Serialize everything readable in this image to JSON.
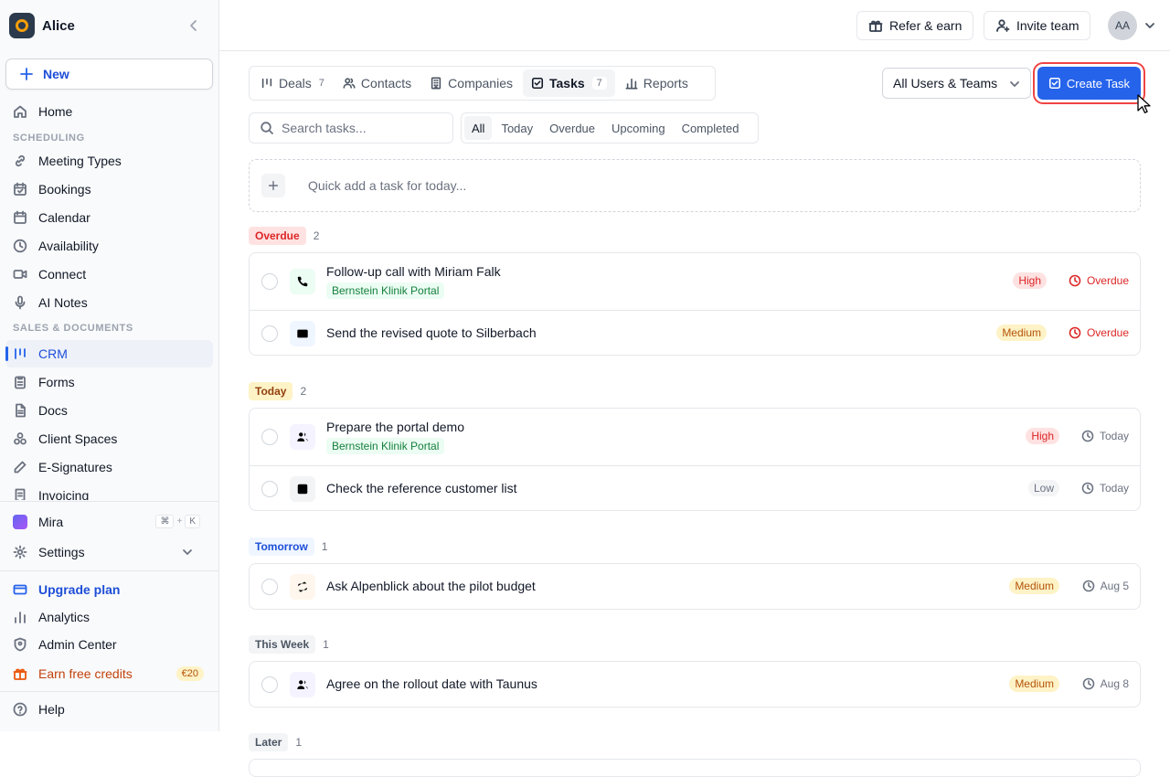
{
  "workspace": {
    "name": "Alice"
  },
  "sidebar": {
    "new_label": "New",
    "nav": [
      {
        "label": "Home",
        "icon": "home-icon"
      },
      {
        "section": "SCHEDULING"
      },
      {
        "label": "Meeting Types",
        "icon": "link-icon"
      },
      {
        "label": "Bookings",
        "icon": "calendar-check-icon"
      },
      {
        "label": "Calendar",
        "icon": "calendar-icon"
      },
      {
        "label": "Availability",
        "icon": "clock-icon"
      },
      {
        "label": "Connect",
        "icon": "video-icon"
      },
      {
        "label": "AI Notes",
        "icon": "microphone-icon"
      },
      {
        "section": "SALES & DOCUMENTS"
      },
      {
        "label": "CRM",
        "icon": "kanban-icon",
        "active": true
      },
      {
        "label": "Forms",
        "icon": "clipboard-icon"
      },
      {
        "label": "Docs",
        "icon": "document-icon"
      },
      {
        "label": "Client Spaces",
        "icon": "cubes-icon"
      },
      {
        "label": "E-Signatures",
        "icon": "pen-icon"
      },
      {
        "label": "Invoicing",
        "icon": "invoice-icon"
      }
    ],
    "mira": {
      "label": "Mira",
      "shortcut": [
        "⌘",
        "+",
        "K"
      ]
    },
    "settings_label": "Settings",
    "upgrade_label": "Upgrade plan",
    "analytics_label": "Analytics",
    "admin_label": "Admin Center",
    "credits_label": "Earn free credits",
    "credits_badge": "€20",
    "help_label": "Help"
  },
  "header": {
    "refer_label": "Refer & earn",
    "invite_label": "Invite team",
    "avatar_initials": "AA"
  },
  "tabs": [
    {
      "label": "Deals",
      "count": "7",
      "icon": "kanban-icon"
    },
    {
      "label": "Contacts",
      "count": "",
      "icon": "users-icon"
    },
    {
      "label": "Companies",
      "count": "",
      "icon": "building-icon"
    },
    {
      "label": "Tasks",
      "count": "7",
      "icon": "checkbox-icon",
      "active": true
    },
    {
      "label": "Reports",
      "count": "",
      "icon": "bar-chart-icon"
    }
  ],
  "user_filter": {
    "value": "All Users & Teams"
  },
  "create_task_label": "Create Task",
  "search": {
    "placeholder": "Search tasks..."
  },
  "filters": [
    {
      "label": "All",
      "active": true
    },
    {
      "label": "Today"
    },
    {
      "label": "Overdue"
    },
    {
      "label": "Upcoming"
    },
    {
      "label": "Completed"
    }
  ],
  "quick_add": {
    "placeholder": "Quick add a task for today..."
  },
  "groups": [
    {
      "label": "Overdue",
      "count": "2",
      "bg": "#fee2e2",
      "fg": "#dc2626",
      "tasks": [
        {
          "title": "Follow-up call with Miriam Falk",
          "tag": "Bernstein Klinik Portal",
          "type_icon": "phone-icon",
          "icon_bg": "#ecfdf3",
          "icon_fg": "#16a34a",
          "priority": "High",
          "prio_class": "p-high",
          "due": "Overdue",
          "due_color": "#dc2626"
        },
        {
          "title": "Send the revised quote to Silberbach",
          "tag": "",
          "type_icon": "mail-icon",
          "icon_bg": "#eff6ff",
          "icon_fg": "#2563eb",
          "priority": "Medium",
          "prio_class": "p-medium",
          "due": "Overdue",
          "due_color": "#dc2626"
        }
      ]
    },
    {
      "label": "Today",
      "count": "2",
      "bg": "#fef3c7",
      "fg": "#92400e",
      "tasks": [
        {
          "title": "Prepare the portal demo",
          "tag": "Bernstein Klinik Portal",
          "type_icon": "users-icon",
          "icon_bg": "#f5f3ff",
          "icon_fg": "#7c3aed",
          "priority": "High",
          "prio_class": "p-high",
          "due": "Today",
          "due_color": "#6b7280"
        },
        {
          "title": "Check the reference customer list",
          "tag": "",
          "type_icon": "checkbox-icon",
          "icon_bg": "#f3f4f6",
          "icon_fg": "#6b7280",
          "priority": "Low",
          "prio_class": "p-low",
          "due": "Today",
          "due_color": "#6b7280"
        }
      ]
    },
    {
      "label": "Tomorrow",
      "count": "1",
      "bg": "#eff6ff",
      "fg": "#1d4ed8",
      "tasks": [
        {
          "title": "Ask Alpenblick about the pilot budget",
          "tag": "",
          "type_icon": "repeat-icon",
          "icon_bg": "#fff7ed",
          "icon_fg": "#ea580c",
          "priority": "Medium",
          "prio_class": "p-medium",
          "due": "Aug 5",
          "due_color": "#6b7280"
        }
      ]
    },
    {
      "label": "This Week",
      "count": "1",
      "bg": "#f3f4f6",
      "fg": "#4b5563",
      "tasks": [
        {
          "title": "Agree on the rollout date with Taunus",
          "tag": "",
          "type_icon": "users-icon",
          "icon_bg": "#f5f3ff",
          "icon_fg": "#7c3aed",
          "priority": "Medium",
          "prio_class": "p-medium",
          "due": "Aug 8",
          "due_color": "#6b7280"
        }
      ]
    },
    {
      "label": "Later",
      "count": "1",
      "bg": "#f3f4f6",
      "fg": "#4b5563",
      "tasks": []
    }
  ]
}
